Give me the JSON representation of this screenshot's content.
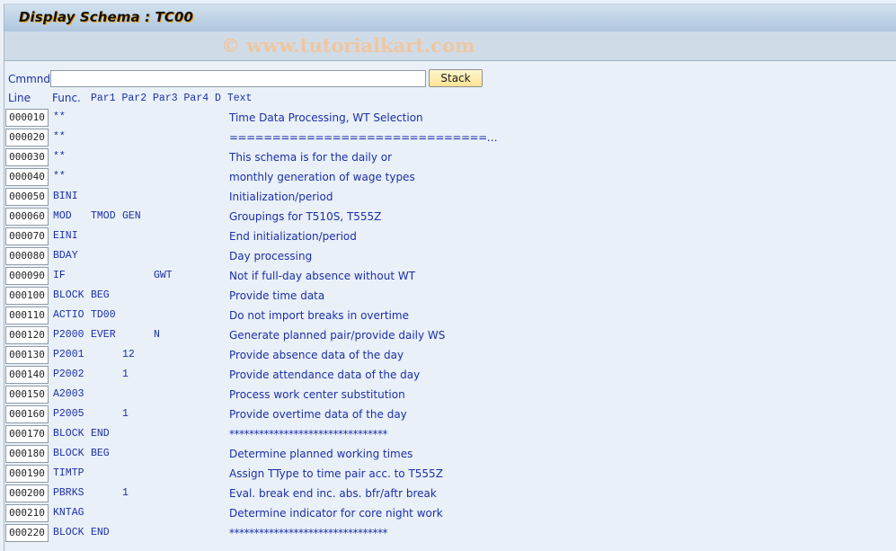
{
  "window": {
    "title": "Display Schema : TC00",
    "watermark": "© www.tutorialkart.com"
  },
  "command": {
    "label": "Cmmnd",
    "value": "",
    "placeholder": "",
    "stack_label": "Stack"
  },
  "columns": {
    "line": "Line",
    "func": "Func.",
    "params": "Par1 Par2 Par3 Par4 D Text"
  },
  "rows": [
    {
      "line": "000010",
      "func": "**",
      "par1": "",
      "par2": "",
      "par3": "",
      "par4": "",
      "d": "",
      "text": "Time Data Processing, WT Selection"
    },
    {
      "line": "000020",
      "func": "**",
      "par1": "",
      "par2": "",
      "par3": "",
      "par4": "",
      "d": "",
      "text": "==============================…"
    },
    {
      "line": "000030",
      "func": "**",
      "par1": "",
      "par2": "",
      "par3": "",
      "par4": "",
      "d": "",
      "text": "This schema is for the daily or"
    },
    {
      "line": "000040",
      "func": "**",
      "par1": "",
      "par2": "",
      "par3": "",
      "par4": "",
      "d": "",
      "text": "monthly generation of wage types"
    },
    {
      "line": "000050",
      "func": "BINI",
      "par1": "",
      "par2": "",
      "par3": "",
      "par4": "",
      "d": "",
      "text": "Initialization/period"
    },
    {
      "line": "000060",
      "func": "MOD",
      "par1": "TMOD",
      "par2": "GEN",
      "par3": "",
      "par4": "",
      "d": "",
      "text": "Groupings for T510S, T555Z"
    },
    {
      "line": "000070",
      "func": "EINI",
      "par1": "",
      "par2": "",
      "par3": "",
      "par4": "",
      "d": "",
      "text": "End initialization/period"
    },
    {
      "line": "000080",
      "func": "BDAY",
      "par1": "",
      "par2": "",
      "par3": "",
      "par4": "",
      "d": "",
      "text": "Day processing"
    },
    {
      "line": "000090",
      "func": "IF",
      "par1": "",
      "par2": "",
      "par3": "GWT",
      "par4": "",
      "d": "",
      "text": "Not if full-day absence without WT"
    },
    {
      "line": "000100",
      "func": "BLOCK",
      "par1": "BEG",
      "par2": "",
      "par3": "",
      "par4": "",
      "d": "",
      "text": "Provide time data"
    },
    {
      "line": "000110",
      "func": "ACTIO",
      "par1": "TD00",
      "par2": "",
      "par3": "",
      "par4": "",
      "d": "",
      "text": "Do not import breaks in overtime"
    },
    {
      "line": "000120",
      "func": "P2000",
      "par1": "EVER",
      "par2": "",
      "par3": "N",
      "par4": "",
      "d": "",
      "text": "Generate planned pair/provide daily WS"
    },
    {
      "line": "000130",
      "func": "P2001",
      "par1": "",
      "par2": "12",
      "par3": "",
      "par4": "",
      "d": "",
      "text": "Provide absence data of the day"
    },
    {
      "line": "000140",
      "func": "P2002",
      "par1": "",
      "par2": "1",
      "par3": "",
      "par4": "",
      "d": "",
      "text": "Provide attendance data of the day"
    },
    {
      "line": "000150",
      "func": "A2003",
      "par1": "",
      "par2": "",
      "par3": "",
      "par4": "",
      "d": "",
      "text": "Process work center substitution"
    },
    {
      "line": "000160",
      "func": "P2005",
      "par1": "",
      "par2": "1",
      "par3": "",
      "par4": "",
      "d": "",
      "text": "Provide overtime data of the day"
    },
    {
      "line": "000170",
      "func": "BLOCK",
      "par1": "END",
      "par2": "",
      "par3": "",
      "par4": "",
      "d": "",
      "text": "********************************"
    },
    {
      "line": "000180",
      "func": "BLOCK",
      "par1": "BEG",
      "par2": "",
      "par3": "",
      "par4": "",
      "d": "",
      "text": "Determine planned working times"
    },
    {
      "line": "000190",
      "func": "TIMTP",
      "par1": "",
      "par2": "",
      "par3": "",
      "par4": "",
      "d": "",
      "text": "Assign TType to time pair acc. to T555Z"
    },
    {
      "line": "000200",
      "func": "PBRKS",
      "par1": "",
      "par2": "1",
      "par3": "",
      "par4": "",
      "d": "",
      "text": "Eval. break end inc. abs. bfr/aftr break"
    },
    {
      "line": "000210",
      "func": "KNTAG",
      "par1": "",
      "par2": "",
      "par3": "",
      "par4": "",
      "d": "",
      "text": "Determine indicator for core night work"
    },
    {
      "line": "000220",
      "func": "BLOCK",
      "par1": "END",
      "par2": "",
      "par3": "",
      "par4": "",
      "d": "",
      "text": "********************************"
    }
  ]
}
